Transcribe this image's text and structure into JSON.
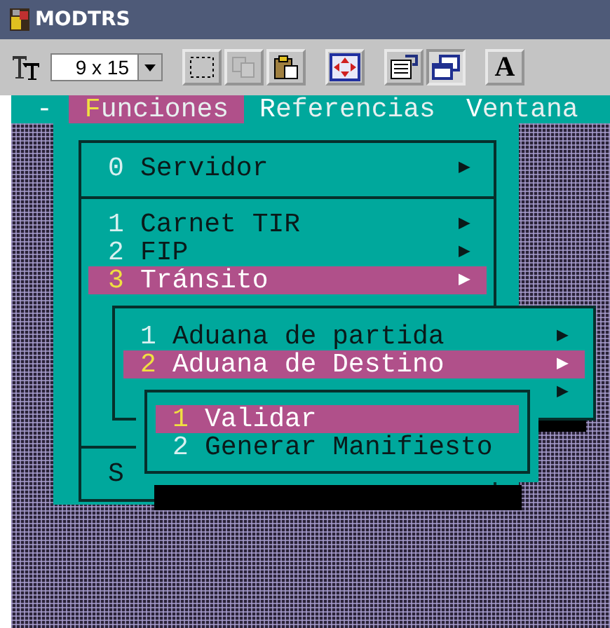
{
  "window": {
    "title": "MODTRS"
  },
  "toolbar": {
    "font_size": "9 x 15",
    "button_groups": [
      [
        {
          "kind": "select-area",
          "disabled": false,
          "pressed": false
        },
        {
          "kind": "copy",
          "disabled": true,
          "pressed": false
        },
        {
          "kind": "paste",
          "disabled": false,
          "pressed": false
        }
      ],
      [
        {
          "kind": "move",
          "disabled": false,
          "pressed": false
        }
      ],
      [
        {
          "kind": "properties",
          "disabled": false,
          "pressed": false
        },
        {
          "kind": "window",
          "disabled": false,
          "pressed": true
        }
      ],
      [
        {
          "kind": "font",
          "label": "A",
          "disabled": false,
          "pressed": false
        }
      ]
    ]
  },
  "menu_bar": [
    {
      "label": "-",
      "selected": false
    },
    {
      "label": "Funciones",
      "selected": true
    },
    {
      "label": "Referencias",
      "selected": false
    },
    {
      "label": "Ventana",
      "selected": false
    }
  ],
  "main_menu": {
    "sections": [
      [
        {
          "key": "0",
          "label": "Servidor",
          "arrow": "▶",
          "selected": false
        }
      ],
      [
        {
          "key": "1",
          "label": "Carnet TIR",
          "arrow": "▶",
          "selected": false
        },
        {
          "key": "2",
          "label": "FIP",
          "arrow": "▶",
          "selected": false
        },
        {
          "key": "3",
          "label": "Tránsito",
          "arrow": "▶",
          "selected": true
        }
      ],
      [
        {
          "label": "S",
          "selected": false
        }
      ]
    ]
  },
  "submenu": {
    "items": [
      {
        "key": "1",
        "label": "Aduana de partida",
        "arrow": "▶",
        "selected": false
      },
      {
        "key": "2",
        "label": "Aduana de Destino",
        "arrow": "▶",
        "selected": true
      },
      {
        "arrow": "▶",
        "selected": false
      }
    ]
  },
  "sub_submenu": {
    "items": [
      {
        "key": "1",
        "label": "Validar",
        "selected": true
      },
      {
        "key": "2",
        "label": "Generar Manifiesto",
        "selected": false
      }
    ]
  }
}
